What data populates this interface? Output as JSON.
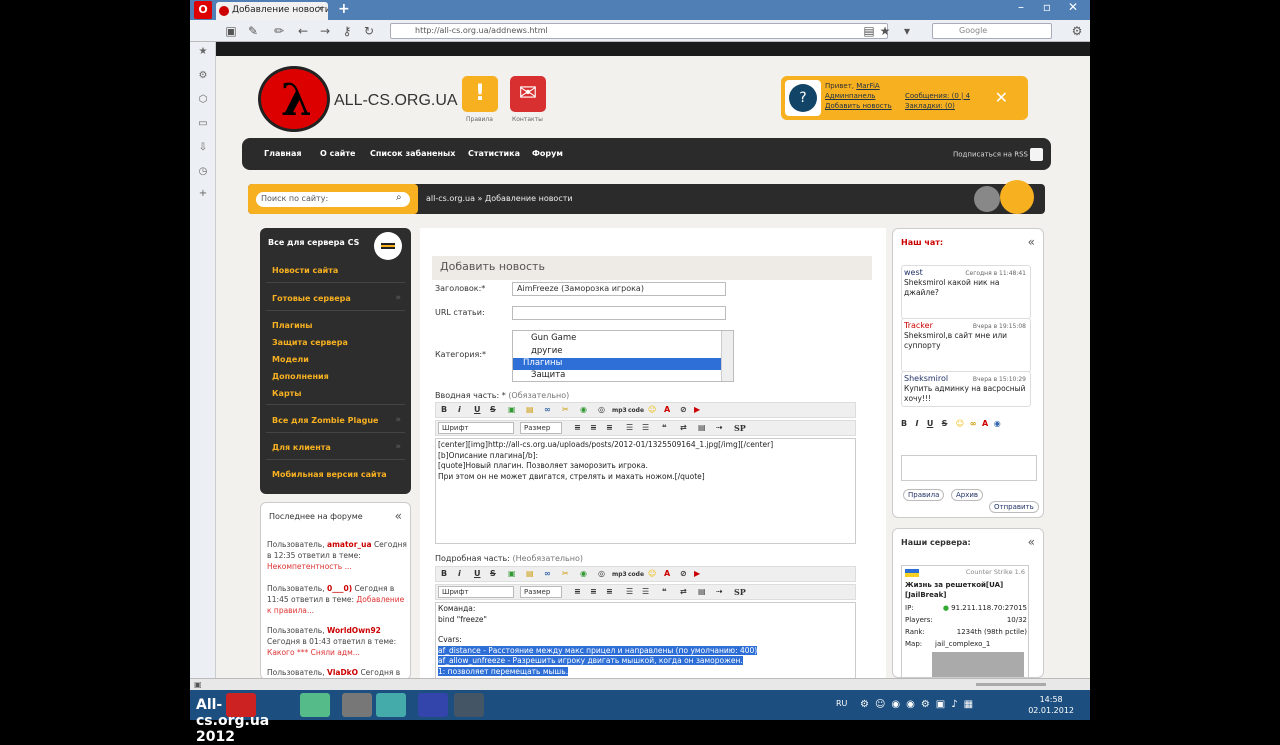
{
  "browser": {
    "tab_title": "Добавление новости ...",
    "url": "http://all-cs.org.ua/addnews.html",
    "search_placeholder": "Google"
  },
  "site": {
    "name": "ALL-CS.ORG.UA",
    "logo_letter": "λ",
    "rules_label": "Правила",
    "contacts_label": "Контакты",
    "user": {
      "greeting": "Привет,",
      "username": "MarFiA",
      "admin_link": "Админпанель",
      "add_news_link": "Добавить новость",
      "messages": "Сообщения: (0 | 4",
      "bookmarks": "Закладки: (0)"
    },
    "menu": [
      "Главная",
      "О сайте",
      "Список забаненых",
      "Статистика",
      "Форум"
    ],
    "rss_label": "Подписаться на RSS",
    "search_placeholder": "Поиск по сайту:",
    "breadcrumb": "all-cs.org.ua » Добавление новости"
  },
  "left_menu": {
    "header": "Все для сервера CS",
    "items": [
      "Новости сайта",
      "Готовые сервера",
      "Плагины",
      "Защита сервера",
      "Модели",
      "Дополнения",
      "Карты",
      "Все для Zombie Plague",
      "Для клиента",
      "Мобильная версия сайта"
    ]
  },
  "forum": {
    "header": "Последнее на форуме",
    "posts": [
      {
        "prefix": "Пользователь,",
        "user": "amator_ua",
        "text": "Сегодня в 12:35 ответил в теме:",
        "topic": "Некомпетентность ..."
      },
      {
        "prefix": "Пользователь,",
        "user": "0___0)",
        "text": "Сегодня в 11:45 ответил в теме:",
        "topic": "Добавление к правила..."
      },
      {
        "prefix": "Пользователь,",
        "user": "WorldOwn92",
        "text": "Сегодня в 01:43 ответил в теме:",
        "topic": "Какого *** Сняли адм..."
      },
      {
        "prefix": "Пользователь,",
        "user": "VlaDkO",
        "text": "Сегодня в",
        "topic": ""
      }
    ]
  },
  "form": {
    "header": "Добавить новость",
    "title_label": "Заголовок:*",
    "title_value": "AimFreeze (Заморозка игрока)",
    "url_label": "URL статьи:",
    "url_value": "",
    "category_label": "Категория:*",
    "categories": [
      "Gun Game",
      "другие",
      "Плагины",
      "Защита"
    ],
    "selected_category": "Плагины",
    "intro_label": "Вводная часть: *",
    "intro_hint": "(Обязательно)",
    "font_select": "Шрифт",
    "size_select": "Размер",
    "intro_lines": [
      "[center][img]http://all-cs.org.ua/uploads/posts/2012-01/1325509164_1.jpg[/img][/center]",
      "[b]Описание плагина[/b]:",
      "[quote]Новый плагин. Позволяет заморозить игрока.",
      "При этом он не может двигатся, стрелять и махать ножом.[/quote]"
    ],
    "full_label": "Подробная часть:",
    "full_hint": "(Необязательно)",
    "full_lines": [
      "Команда:",
      "bind \"freeze\"",
      "",
      "Cvars:"
    ],
    "full_selected_lines": [
      "af_distance - Расстояние между макс прицел и направлены (по умолчанию: 400)",
      "af_allow_unfreeze - Разрешить игроку двигать мышкой, когда он заморожен.",
      "1: позволяет перемещать мышь."
    ]
  },
  "chat": {
    "header": "Наш чат:",
    "messages": [
      {
        "name": "west",
        "time": "Сегодня в 11:48:41",
        "text": "Sheksmirol какой ник на джайле?"
      },
      {
        "name": "Tracker",
        "time": "Вчера в 19:15:08",
        "text": "Sheksmirol,в сайт мне или суппорту"
      },
      {
        "name": "Sheksmirol",
        "time": "Вчера в 15:10:29",
        "text": "Купить админку на васросный хочу!!!"
      }
    ],
    "rules_btn": "Правила",
    "archive_btn": "Архив",
    "send_btn": "Отправить"
  },
  "servers": {
    "header": "Наши сервера:",
    "game": "Counter Strike 1.6",
    "name": "Жизнь за решеткой[UA] [JailBreak]",
    "ip_label": "IP:",
    "ip": "91.211.118.70:27015",
    "players_label": "Players:",
    "players": "10/32",
    "rank_label": "Rank:",
    "rank": "1234th (98th pctile)",
    "map_label": "Map:",
    "map": "jail_complexo_1"
  },
  "taskbar": {
    "start_text": "All-cs.org.ua 2012",
    "lang": "RU",
    "time": "14:58",
    "date": "02.01.2012"
  }
}
